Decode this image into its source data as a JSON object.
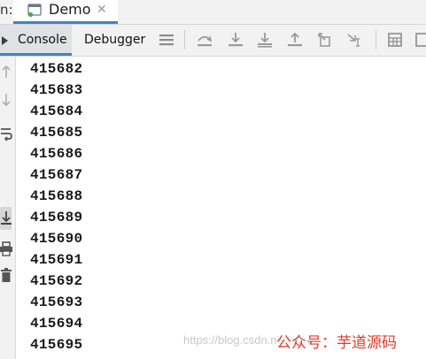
{
  "window": {
    "prefix": "n:",
    "run_tab_label": "Demo",
    "close_glyph": "✕"
  },
  "toolbar": {
    "console_label": "Console",
    "debugger_label": "Debugger"
  },
  "icons": {
    "run_tab": "java-class-icon",
    "console": "console-icon",
    "toolbar": [
      "menu-icon",
      "step-over-icon",
      "step-into-icon",
      "force-step-into-icon",
      "step-out-icon",
      "drop-frame-icon",
      "run-to-cursor-icon",
      "evaluate-expression-icon"
    ],
    "gutter": [
      "up-arrow-icon",
      "down-arrow-icon",
      "soft-wrap-icon",
      "scroll-to-end-icon",
      "print-icon",
      "clear-all-icon"
    ]
  },
  "output": {
    "lines": [
      "415682",
      "415683",
      "415684",
      "415685",
      "415686",
      "415687",
      "415688",
      "415689",
      "415690",
      "415691",
      "415692",
      "415693",
      "415694",
      "415695"
    ]
  },
  "watermark": {
    "url_text": "https://blog.csdn.net/ng",
    "cn_text": "公众号：芋道源码"
  },
  "colors": {
    "accent": "#4083c9",
    "watermark_red": "#e03a2b",
    "panel_bg": "#f2f2f2"
  }
}
